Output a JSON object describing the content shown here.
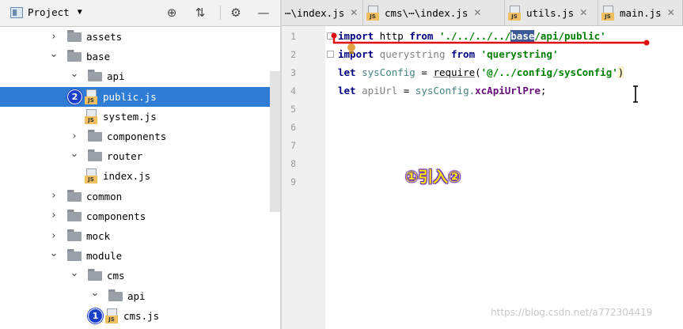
{
  "project_panel": {
    "title": "Project",
    "tree": [
      {
        "label": "assets",
        "type": "folder",
        "expanded": false,
        "depth": 1
      },
      {
        "label": "base",
        "type": "folder",
        "expanded": true,
        "depth": 1
      },
      {
        "label": "api",
        "type": "folder",
        "expanded": true,
        "depth": 2
      },
      {
        "label": "public.js",
        "type": "file",
        "depth": 3,
        "selected": true,
        "badge": "2"
      },
      {
        "label": "system.js",
        "type": "file",
        "depth": 3
      },
      {
        "label": "components",
        "type": "folder",
        "expanded": false,
        "depth": 2
      },
      {
        "label": "router",
        "type": "folder",
        "expanded": true,
        "depth": 2
      },
      {
        "label": "index.js",
        "type": "file",
        "depth": 3
      },
      {
        "label": "common",
        "type": "folder",
        "expanded": false,
        "depth": 1
      },
      {
        "label": "components",
        "type": "folder",
        "expanded": false,
        "depth": 1
      },
      {
        "label": "mock",
        "type": "folder",
        "expanded": false,
        "depth": 1
      },
      {
        "label": "module",
        "type": "folder",
        "expanded": true,
        "depth": 1
      },
      {
        "label": "cms",
        "type": "folder",
        "expanded": true,
        "depth": 2
      },
      {
        "label": "api",
        "type": "folder",
        "expanded": true,
        "depth": 3
      },
      {
        "label": "cms.js",
        "type": "file",
        "depth": 4,
        "badge": "1"
      }
    ],
    "header_icons": [
      "crosshair-icon",
      "collapse-icon",
      "gear-icon",
      "minimize-icon"
    ]
  },
  "editor": {
    "tabs": [
      {
        "label": "\\index.js",
        "prefix": "⋯",
        "icon": false
      },
      {
        "label": "cms\\⋯\\index.js",
        "icon": true
      },
      {
        "label": "utils.js",
        "icon": true
      },
      {
        "label": "main.js",
        "icon": true
      }
    ],
    "line_numbers": [
      "1",
      "2",
      "3",
      "4",
      "5",
      "6",
      "7",
      "8",
      "9"
    ],
    "code": {
      "l1": {
        "kw1": "import",
        "name": " http ",
        "kw2": "from",
        "str_pre": " './../../../",
        "str_hl": "base",
        "str_post": "/api/public'"
      },
      "l2": {
        "kw1": "import",
        "name": " querystring ",
        "kw2": "from",
        "str": " 'querystring'"
      },
      "l3": {
        "kw": "let",
        "name": " sysConfig ",
        "eq": "= ",
        "fn": "require",
        "open": "(",
        "str": "'@/../config/sysConfig'",
        "close": ")"
      },
      "l4": {
        "kw": "let",
        "name": " apiUrl ",
        "eq": "= ",
        "obj": "sysConfig.",
        "prop": "xcApiUrlPre",
        "end": ";"
      }
    },
    "annotation": "①引入②",
    "watermark": "https://blog.csdn.net/a772304419"
  },
  "colors": {
    "selection": "#2e7cd3",
    "badge": "#1a3fc9",
    "annotation": "#f5e100",
    "red_mark": "#e01010"
  }
}
